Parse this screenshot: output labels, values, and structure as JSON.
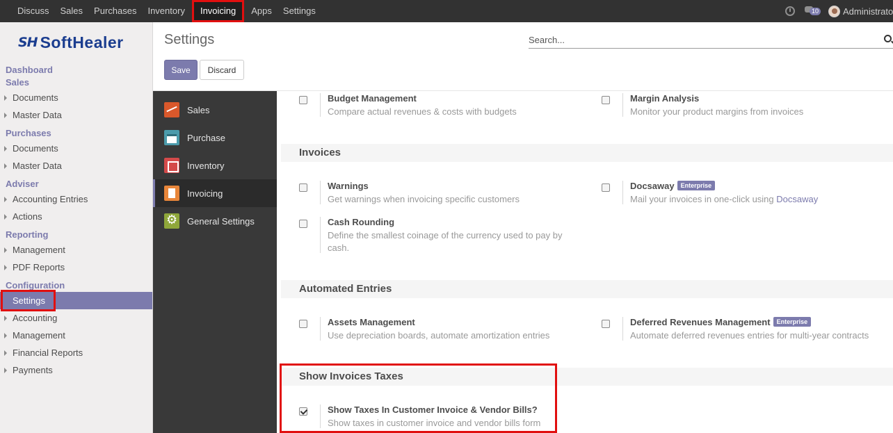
{
  "topbar": {
    "menu": [
      "Discuss",
      "Sales",
      "Purchases",
      "Inventory",
      "Invoicing",
      "Apps",
      "Settings"
    ],
    "active": "Invoicing",
    "notification_count": "10",
    "user": "Administrator"
  },
  "sidebar": {
    "logo_mark": "SH",
    "logo_text": "SoftHealer",
    "sections": [
      {
        "title": "Dashboard",
        "items": []
      },
      {
        "title": "Sales",
        "items": [
          "Documents",
          "Master Data"
        ]
      },
      {
        "title": "Purchases",
        "items": [
          "Documents",
          "Master Data"
        ]
      },
      {
        "title": "Adviser",
        "items": [
          "Accounting Entries",
          "Actions"
        ]
      },
      {
        "title": "Reporting",
        "items": [
          "Management",
          "PDF Reports"
        ]
      },
      {
        "title": "Configuration",
        "items": [
          "Settings",
          "Accounting",
          "Management",
          "Financial Reports",
          "Payments"
        ]
      }
    ],
    "selected_item": "Settings"
  },
  "header": {
    "title": "Settings",
    "search_placeholder": "Search...",
    "save_label": "Save",
    "discard_label": "Discard"
  },
  "apps": [
    {
      "label": "Sales",
      "icon": "sales-icon"
    },
    {
      "label": "Purchase",
      "icon": "purchase-icon"
    },
    {
      "label": "Inventory",
      "icon": "inventory-icon"
    },
    {
      "label": "Invoicing",
      "icon": "invoicing-icon"
    },
    {
      "label": "General Settings",
      "icon": "gear-icon"
    }
  ],
  "content": {
    "budget": {
      "title": "Budget Management",
      "desc": "Compare actual revenues & costs with budgets",
      "checked": false
    },
    "margin": {
      "title": "Margin Analysis",
      "desc": "Monitor your product margins from invoices",
      "checked": false
    },
    "invoices_section": "Invoices",
    "warnings": {
      "title": "Warnings",
      "desc": "Get warnings when invoicing specific customers",
      "checked": false
    },
    "docsaway": {
      "title": "Docsaway",
      "badge": "Enterprise",
      "desc_prefix": "Mail your invoices in one-click using ",
      "desc_link": "Docsaway",
      "checked": false
    },
    "cash_rounding": {
      "title": "Cash Rounding",
      "desc": "Define the smallest coinage of the currency used to pay by cash.",
      "checked": false
    },
    "automated_section": "Automated Entries",
    "assets": {
      "title": "Assets Management",
      "desc": "Use depreciation boards, automate amortization entries",
      "checked": false
    },
    "deferred": {
      "title": "Deferred Revenues Management",
      "badge": "Enterprise",
      "desc": "Automate deferred revenues entries for multi-year contracts",
      "checked": false
    },
    "taxes_section": "Show Invoices Taxes",
    "show_taxes": {
      "title": "Show Taxes In Customer Invoice & Vendor Bills?",
      "desc": "Show taxes in customer invoice and vendor bills form",
      "checked": true
    }
  }
}
